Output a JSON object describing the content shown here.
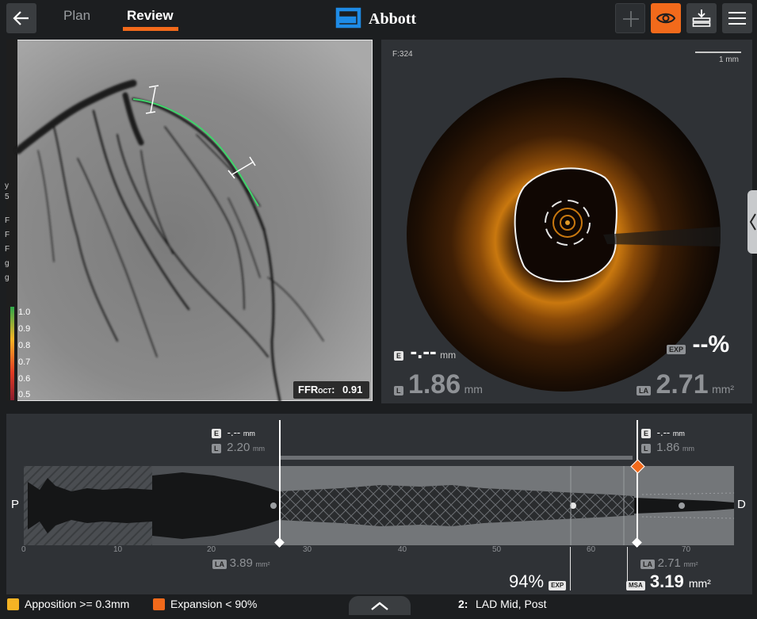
{
  "header": {
    "tabs": [
      {
        "label": "Plan",
        "active": false
      },
      {
        "label": "Review",
        "active": true
      }
    ],
    "brand": "Abbott",
    "accent_color": "#f26a1b",
    "buttons": [
      "back-arrow-icon",
      "add-icon",
      "eye-icon",
      "export-icon",
      "menu-icon"
    ]
  },
  "angio": {
    "legend_labels": [
      "1.0",
      "0.9",
      "0.8",
      "0.7",
      "0.6",
      "0.5"
    ],
    "side_glyphs": [
      "y",
      "5",
      "F",
      "F",
      "F",
      "g",
      "g"
    ],
    "ffr_label": "FFR",
    "ffr_sub": "OCT",
    "ffr_colon": ":",
    "ffr_value": "0.91"
  },
  "oct": {
    "frame": "F:324",
    "scale_label": "1 mm",
    "e_badge": "E",
    "e_value": "-.--",
    "e_unit": "mm",
    "exp_badge": "EXP",
    "exp_value": "--%",
    "l_badge": "L",
    "l_value": "1.86",
    "l_unit": "mm",
    "la_badge": "LA",
    "la_value": "2.71",
    "la_unit": "mm²"
  },
  "pullback": {
    "p_label": "P",
    "d_label": "D",
    "axis_ticks": [
      "0",
      "10",
      "20",
      "30",
      "40",
      "50",
      "60",
      "70"
    ],
    "left_marker": {
      "e_badge": "E",
      "e_value": "-.--",
      "e_unit": "mm",
      "l_badge": "L",
      "l_value": "2.20",
      "l_unit": "mm",
      "la_badge": "LA",
      "la_value": "3.89",
      "la_unit": "mm²"
    },
    "right_marker": {
      "e_badge": "E",
      "e_value": "-.--",
      "e_unit": "mm",
      "l_badge": "L",
      "l_value": "1.86",
      "l_unit": "mm",
      "la_badge": "LA",
      "la_value": "2.71",
      "la_unit": "mm²"
    },
    "exp_value": "94%",
    "exp_badge": "EXP",
    "msa_badge": "MSA",
    "msa_value": "3.19",
    "msa_unit": "mm²"
  },
  "footer": {
    "apposition_label": "Apposition >=  0.3mm",
    "apposition_color": "#f5b324",
    "expansion_label": "Expansion < 90%",
    "expansion_color": "#f26a1b",
    "segment_number": "2:",
    "segment_label": "LAD Mid, Post"
  }
}
